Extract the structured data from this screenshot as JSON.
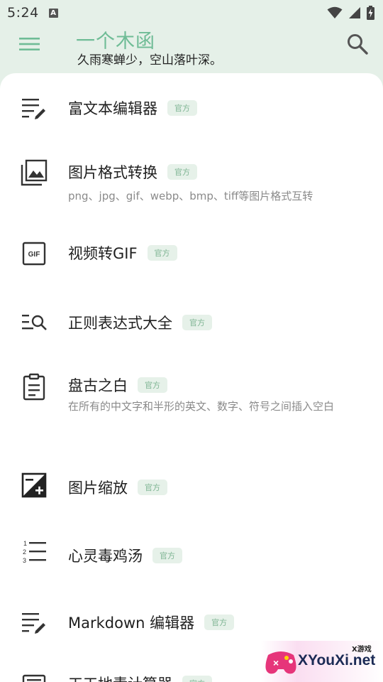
{
  "status": {
    "time": "5:24",
    "notif_letter": "A"
  },
  "header": {
    "title": "一个木函",
    "subtitle": "久雨寒蝉少，空山落叶深。"
  },
  "colors": {
    "accent": "#6fbc96",
    "badge_bg": "#e6f1e9",
    "badge_text": "#7fb593",
    "header_bg": "#e5f0e8"
  },
  "items": [
    {
      "name": "富文本编辑器",
      "badge": "官方",
      "desc": "",
      "icon": "edit-notes-icon"
    },
    {
      "name": "图片格式转换",
      "badge": "官方",
      "desc": "png、jpg、gif、webp、bmp、tiff等图片格式互转",
      "icon": "photo-library-icon"
    },
    {
      "name": "视频转GIF",
      "badge": "官方",
      "desc": "",
      "icon": "gif-box-icon"
    },
    {
      "name": "正则表达式大全",
      "badge": "官方",
      "desc": "",
      "icon": "list-search-icon"
    },
    {
      "name": "盘古之白",
      "badge": "官方",
      "desc": "在所有的中文字和半形的英文、数字、符号之间插入空白",
      "icon": "clipboard-text-icon"
    },
    {
      "name": "图片缩放",
      "badge": "官方",
      "desc": "",
      "icon": "exposure-icon"
    },
    {
      "name": "心灵毒鸡汤",
      "badge": "官方",
      "desc": "",
      "icon": "numbered-list-icon"
    },
    {
      "name": "Markdown 编辑器",
      "badge": "官方",
      "desc": "",
      "icon": "edit-notes-icon"
    },
    {
      "name": "工工地责计算器",
      "badge": "官方",
      "desc": "",
      "icon": "calculator-icon"
    }
  ],
  "watermark": {
    "small": "X游戏",
    "main": "XYouXi.net"
  }
}
